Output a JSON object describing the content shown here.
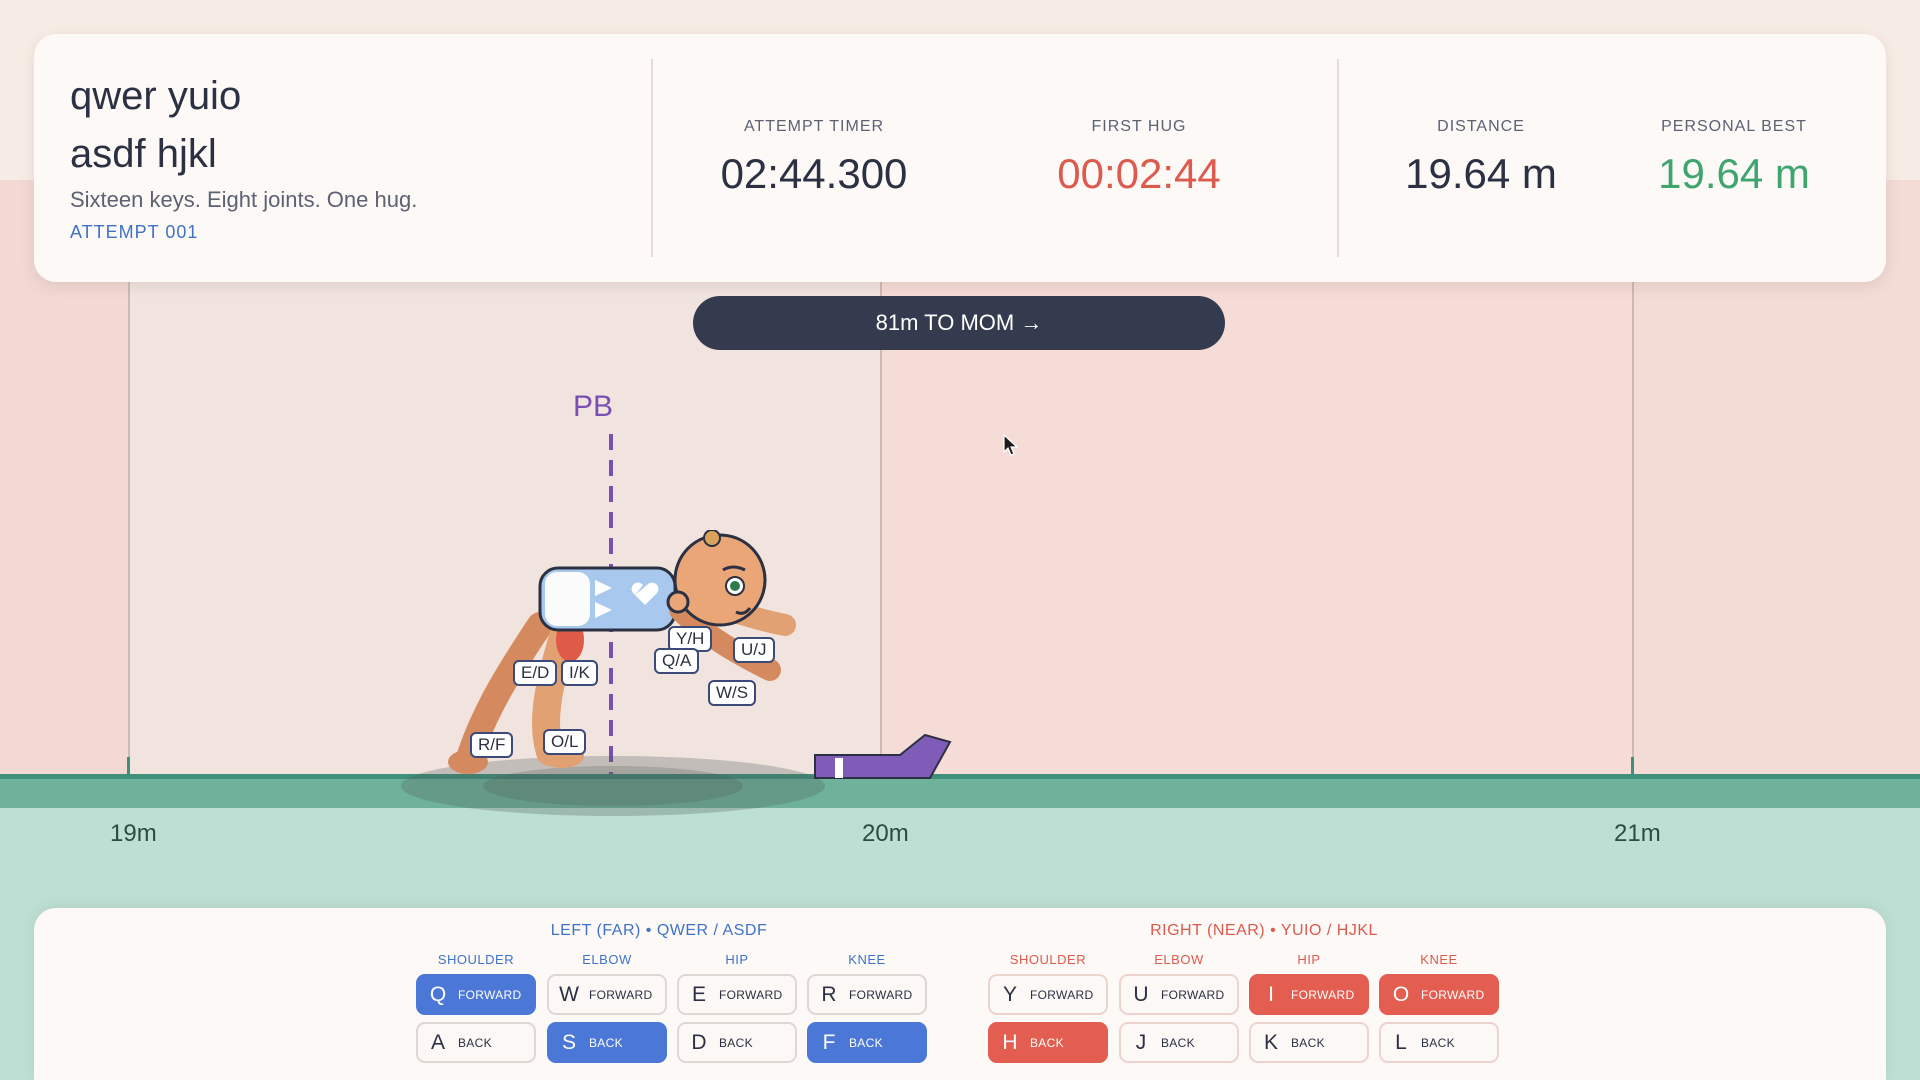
{
  "header": {
    "title_line1": "qwer yuio",
    "title_line2": "asdf hjkl",
    "subtitle": "Sixteen keys. Eight joints. One hug.",
    "attempt": "ATTEMPT  001",
    "stats": {
      "attempt_timer": {
        "label": "ATTEMPT TIMER",
        "value": "02:44.300"
      },
      "first_hug": {
        "label": "FIRST HUG",
        "value": "00:02:44"
      },
      "distance": {
        "label": "DISTANCE",
        "value": "19.64 m"
      },
      "personal_best": {
        "label": "PERSONAL BEST",
        "value": "19.64 m"
      }
    }
  },
  "banner": {
    "text": "81m TO MOM  →"
  },
  "track": {
    "pb_label": "PB",
    "markers": [
      "19m",
      "20m",
      "21m"
    ]
  },
  "baby_tags": {
    "yh": "Y/H",
    "uj": "U/J",
    "qa": "Q/A",
    "ws": "W/S",
    "ed": "E/D",
    "ik": "I/K",
    "rf": "R/F",
    "ol": "O/L"
  },
  "controls": {
    "left": {
      "title": "LEFT (FAR)  •  QWER / ASDF",
      "joints": [
        {
          "label": "SHOULDER",
          "forward": {
            "key": "Q",
            "action": "FORWARD",
            "active": true
          },
          "back": {
            "key": "A",
            "action": "BACK",
            "active": false
          }
        },
        {
          "label": "ELBOW",
          "forward": {
            "key": "W",
            "action": "FORWARD",
            "active": false
          },
          "back": {
            "key": "S",
            "action": "BACK",
            "active": true
          }
        },
        {
          "label": "HIP",
          "forward": {
            "key": "E",
            "action": "FORWARD",
            "active": false
          },
          "back": {
            "key": "D",
            "action": "BACK",
            "active": false
          }
        },
        {
          "label": "KNEE",
          "forward": {
            "key": "R",
            "action": "FORWARD",
            "active": false
          },
          "back": {
            "key": "F",
            "action": "BACK",
            "active": true
          }
        }
      ]
    },
    "right": {
      "title": "RIGHT (NEAR)  •  YUIO / HJKL",
      "joints": [
        {
          "label": "SHOULDER",
          "forward": {
            "key": "Y",
            "action": "FORWARD",
            "active": false
          },
          "back": {
            "key": "H",
            "action": "BACK",
            "active": true
          }
        },
        {
          "label": "ELBOW",
          "forward": {
            "key": "U",
            "action": "FORWARD",
            "active": false
          },
          "back": {
            "key": "J",
            "action": "BACK",
            "active": false
          }
        },
        {
          "label": "HIP",
          "forward": {
            "key": "I",
            "action": "FORWARD",
            "active": true
          },
          "back": {
            "key": "K",
            "action": "BACK",
            "active": false
          }
        },
        {
          "label": "KNEE",
          "forward": {
            "key": "O",
            "action": "FORWARD",
            "active": true
          },
          "back": {
            "key": "L",
            "action": "BACK",
            "active": false
          }
        }
      ]
    }
  },
  "colors": {
    "accent_blue": "#4b78d6",
    "accent_red": "#e35e50",
    "pb_purple": "#7a4fb3",
    "ground_green": "#6fb29c",
    "banner_navy": "#343b4f"
  }
}
